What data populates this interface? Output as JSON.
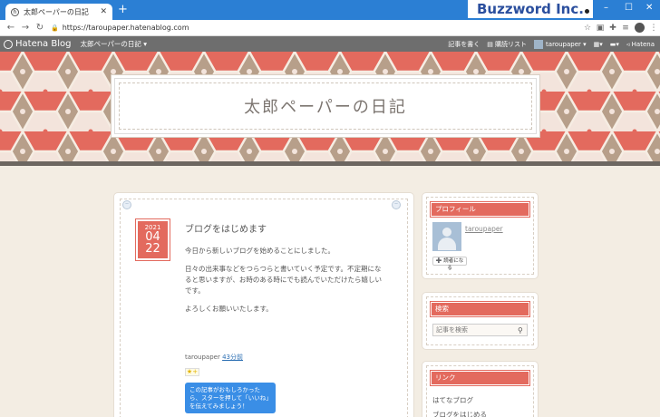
{
  "browser": {
    "tab_title": "太郎ペーパーの日記",
    "url": "https://taroupaper.hatenablog.com",
    "brand": "Buzzword Inc.",
    "win_min": "–",
    "win_max": "☐",
    "win_close": "✕"
  },
  "hatena_bar": {
    "logo": "Hatena Blog",
    "blog_name": "太郎ペーパーの日記 ▾",
    "write": "記事を書く",
    "reader": "購読リスト",
    "user": "taroupaper ▾",
    "hatena": "Hatena"
  },
  "header": {
    "title": "太郎ペーパーの日記"
  },
  "article": {
    "date_year": "2021",
    "date_month": "04",
    "date_day": "22",
    "title": "ブログをはじめます",
    "paragraphs": [
      "今日から新しいブログを始めることにしました。",
      "日々の出来事などをつらつらと書いていく予定です。不定期になると思いますが、お時のある時にでも読んでいただけたら嬉しいです。",
      "よろしくお願いいたします。"
    ],
    "author": "taroupaper",
    "time_ago": "43分前",
    "star": "★+",
    "tooltip": "この記事がおもしろかったら、スターを押して「いいね」を伝えてみましょう！"
  },
  "sidebar": {
    "profile_title": "プロフィール",
    "profile_name": "taroupaper",
    "reader_button": "➕ 読者になる",
    "search_title": "検索",
    "search_placeholder": "記事を検索",
    "links_title": "リンク",
    "links": [
      "はてなブログ",
      "ブログをはじめる"
    ]
  },
  "colors": {
    "accent": "#e36a5e",
    "tab_strip": "#2b7fd4",
    "hatena_bar": "#6e6e6e"
  }
}
